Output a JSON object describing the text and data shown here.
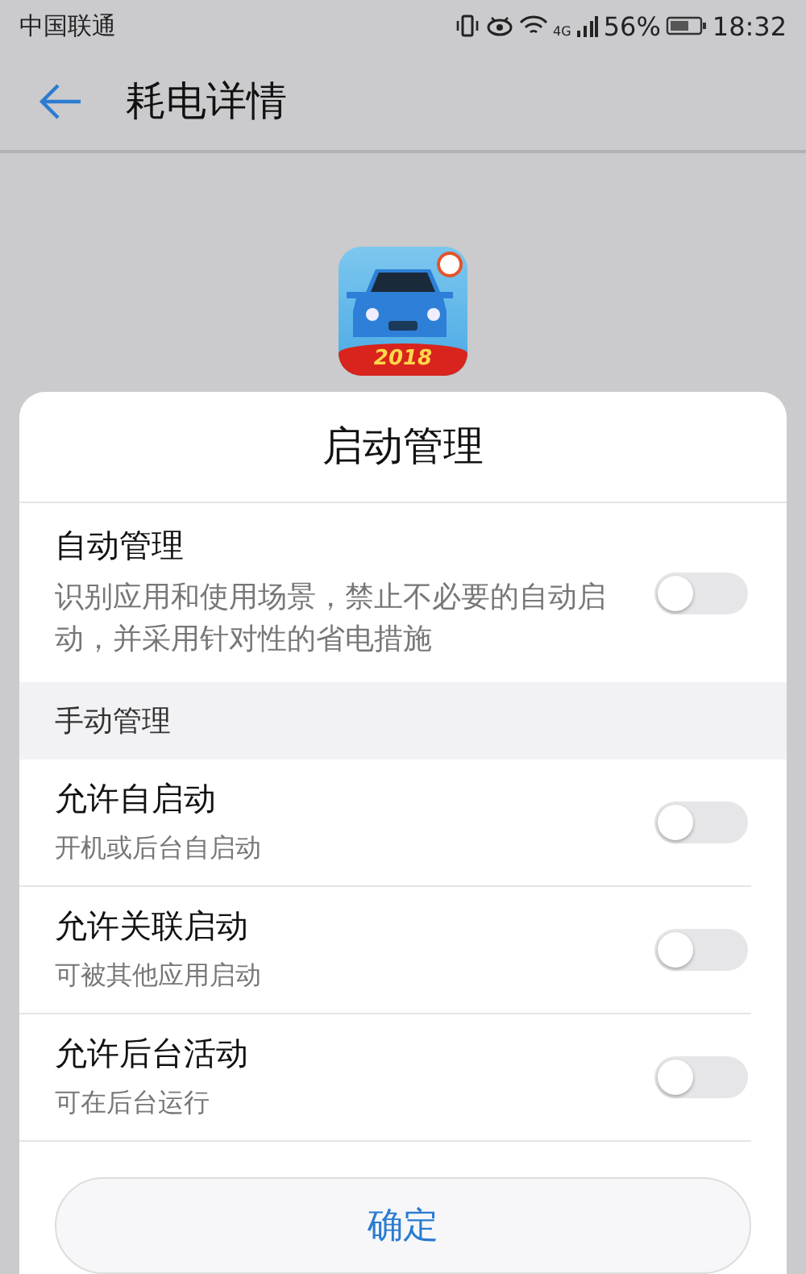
{
  "status_bar": {
    "carrier": "中国联通",
    "network": "4G",
    "battery": "56%",
    "time": "18:32"
  },
  "header": {
    "title": "耗电详情"
  },
  "app": {
    "badge": "2018"
  },
  "sheet": {
    "title": "启动管理",
    "auto": {
      "label": "自动管理",
      "description": "识别应用和使用场景，禁止不必要的自动启动，并采用针对性的省电措施",
      "on": false
    },
    "section": "手动管理",
    "items": [
      {
        "label": "允许自启动",
        "description": "开机或后台自启动",
        "on": false
      },
      {
        "label": "允许关联启动",
        "description": "可被其他应用启动",
        "on": false
      },
      {
        "label": "允许后台活动",
        "description": "可在后台运行",
        "on": false
      }
    ],
    "confirm": "确定"
  }
}
